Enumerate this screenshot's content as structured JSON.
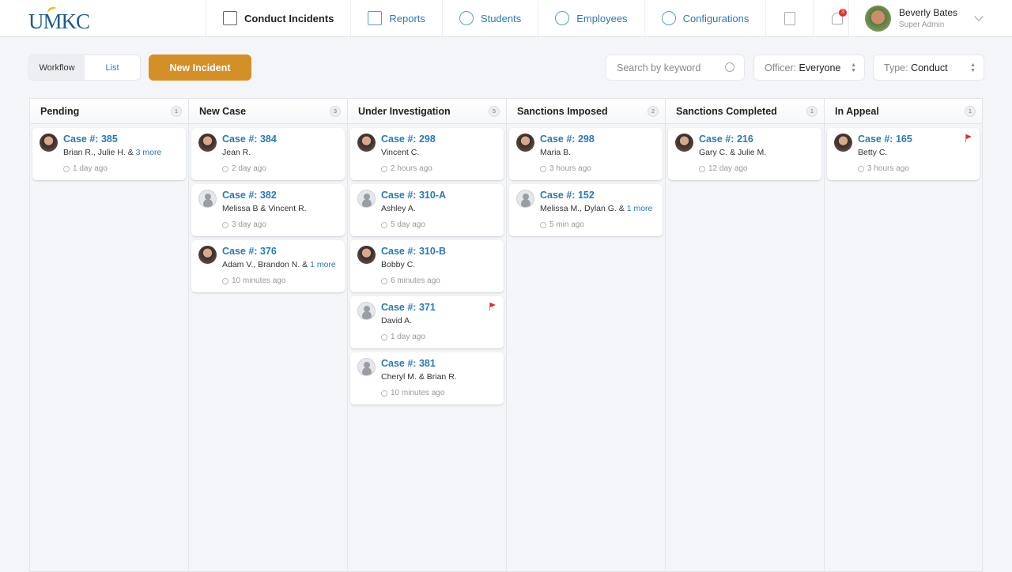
{
  "brand": {
    "logo": "UMKC"
  },
  "nav": [
    {
      "label": "Conduct Incidents",
      "icon": "folder-icon",
      "active": true
    },
    {
      "label": "Reports",
      "icon": "chart-icon"
    },
    {
      "label": "Students",
      "icon": "students-icon"
    },
    {
      "label": "Employees",
      "icon": "employee-icon"
    },
    {
      "label": "Configurations",
      "icon": "gear-icon"
    }
  ],
  "notifications": {
    "count": "3"
  },
  "user": {
    "name": "Beverly Bates",
    "role": "Super Admin"
  },
  "toolbar": {
    "workflow": "Workflow",
    "list": "List",
    "new_incident": "New Incident",
    "search_placeholder": "Search by keyword",
    "officer_label": "Officer:",
    "officer_value": "Everyone",
    "type_label": "Type:",
    "type_value": "Conduct"
  },
  "colors": {
    "accent": "#d48f26",
    "link": "#2a7ab5",
    "flag": "#e52b2b"
  },
  "columns": [
    {
      "title": "Pending",
      "count": "1",
      "cards": [
        {
          "case": "Case #: 385",
          "people": "Brian R., Julie H. & ",
          "more": "3 more",
          "time": "1 day ago",
          "avatar": "photo"
        }
      ]
    },
    {
      "title": "New Case",
      "count": "3",
      "cards": [
        {
          "case": "Case #: 384",
          "people": "Jean R.",
          "time": "2 day ago",
          "avatar": "photo"
        },
        {
          "case": "Case #: 382",
          "people": "Melissa B & Vincent R.",
          "time": "3 day ago",
          "avatar": "placeholder"
        },
        {
          "case": "Case #: 376",
          "people": "Adam V., Brandon N. & ",
          "more": "1 more",
          "time": "10 minutes ago",
          "avatar": "photo"
        }
      ]
    },
    {
      "title": "Under Investigation",
      "count": "5",
      "cards": [
        {
          "case": "Case #: 298",
          "people": "Vincent C.",
          "time": "2 hours ago",
          "avatar": "photo"
        },
        {
          "case": "Case #: 310-A",
          "people": "Ashley A.",
          "time": "5 day ago",
          "avatar": "placeholder"
        },
        {
          "case": "Case #: 310-B",
          "people": "Bobby C.",
          "time": "6 minutes ago",
          "avatar": "photo"
        },
        {
          "case": "Case #: 371",
          "people": "David A.",
          "time": "1 day ago",
          "avatar": "placeholder",
          "flag": true
        },
        {
          "case": "Case #: 381",
          "people": "Cheryl M. & Brian R.",
          "time": "10 minutes ago",
          "avatar": "placeholder"
        }
      ]
    },
    {
      "title": "Sanctions Imposed",
      "count": "2",
      "cards": [
        {
          "case": "Case #: 298",
          "people": "Maria B.",
          "time": "3 hours ago",
          "avatar": "photo"
        },
        {
          "case": "Case #: 152",
          "people": "Melissa M., Dylan G. & ",
          "more": "1 more",
          "time": "5 min ago",
          "avatar": "placeholder"
        }
      ]
    },
    {
      "title": "Sanctions Completed",
      "count": "1",
      "cards": [
        {
          "case": "Case #: 216",
          "people": "Gary C. & Julie M.",
          "time": "12 day ago",
          "avatar": "photo"
        }
      ]
    },
    {
      "title": "In Appeal",
      "count": "1",
      "cards": [
        {
          "case": "Case #: 165",
          "people": "Betty C.",
          "time": "3 hours ago",
          "avatar": "photo",
          "flag": true
        }
      ]
    }
  ]
}
